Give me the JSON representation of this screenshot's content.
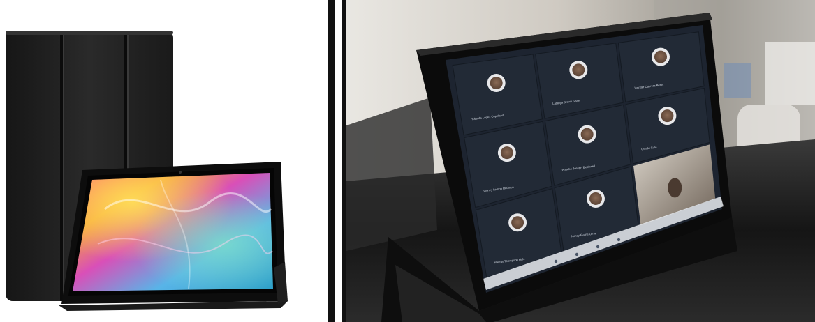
{
  "scene": {
    "left_photo": {
      "subject": "tablet-with-folio-case"
    },
    "right_photo": {
      "subject": "tablet-video-call"
    },
    "colors": {
      "case": "#1c1c1c",
      "divider": "#111111",
      "call_background": "#1d2430",
      "tile": "#222a36"
    }
  },
  "video_call": {
    "participants": [
      {
        "name": "Yolanda Lopez Copeland"
      },
      {
        "name": "Latanya Brown Shaw"
      },
      {
        "name": "Jennifer Cabrera Bettis"
      },
      {
        "name": "Sydney Lemon Redmon"
      },
      {
        "name": "Phoebe Joseph Blackwell"
      },
      {
        "name": "Gerald Gale"
      },
      {
        "name": "Marcus Thompson Hale"
      },
      {
        "name": "Nancy Evans Orme"
      }
    ]
  }
}
